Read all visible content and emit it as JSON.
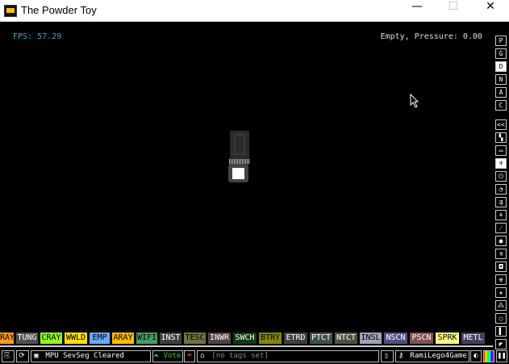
{
  "window": {
    "title": "The Powder Toy",
    "min": "—",
    "max": "☐",
    "close": "✕"
  },
  "hud": {
    "fps_label": "FPS:",
    "fps_value": "57.29",
    "status": "Empty, Pressure: 0.00"
  },
  "right_menu": [
    {
      "label": "P",
      "name": "pause-sim-button"
    },
    {
      "label": "G",
      "name": "gravity-button"
    },
    {
      "label": "D",
      "name": "decorations-button",
      "selected": true
    },
    {
      "label": "N",
      "name": "newtonian-button"
    },
    {
      "label": "A",
      "name": "ambient-heat-button"
    },
    {
      "label": "C",
      "name": "console-button"
    },
    {
      "label": "<<",
      "name": "menu-collapse-button"
    },
    {
      "label": "▚",
      "name": "walls-category-button"
    },
    {
      "label": "▭",
      "name": "electronics-category-button"
    },
    {
      "label": "♆",
      "name": "powered-category-button",
      "selected": true
    },
    {
      "label": "⏻",
      "name": "sensors-category-button"
    },
    {
      "label": "◔",
      "name": "force-category-button"
    },
    {
      "label": "⇶",
      "name": "explosives-category-button"
    },
    {
      "label": "⚘",
      "name": "gases-category-button"
    },
    {
      "label": "⁄",
      "name": "liquids-category-button"
    },
    {
      "label": "●",
      "name": "powders-category-button"
    },
    {
      "label": "⚗",
      "name": "solids-category-button"
    },
    {
      "label": "◘",
      "name": "radioactive-category-button"
    },
    {
      "label": "☢",
      "name": "special-category-button"
    },
    {
      "label": "★",
      "name": "life-category-button"
    },
    {
      "label": "⁂",
      "name": "tools-category-button"
    },
    {
      "label": "○",
      "name": "favorites-category-button"
    },
    {
      "label": "▌",
      "name": "decoration-tools-button"
    },
    {
      "label": "◤",
      "name": "search-category-button"
    },
    {
      "label": "🔍",
      "name": "search-elements-button"
    }
  ],
  "elements": [
    {
      "label": "RAY",
      "bg": "#ff9a1e",
      "fg": "#000",
      "w": 17
    },
    {
      "label": "TUNG",
      "bg": "#505050",
      "fg": "#fff",
      "w": 27
    },
    {
      "label": "CRAY",
      "bg": "#8dff1f",
      "fg": "#000",
      "w": 27
    },
    {
      "label": "WWLD",
      "bg": "#ffe000",
      "fg": "#000",
      "w": 28
    },
    {
      "label": "EMP",
      "bg": "#66aaff",
      "fg": "#000",
      "w": 25
    },
    {
      "label": "ARAY",
      "bg": "#ffbb00",
      "fg": "#000",
      "w": 27
    },
    {
      "label": "WIFI",
      "bg": "#40a060",
      "fg": "#000",
      "w": 26
    },
    {
      "label": "INST",
      "bg": "#404040",
      "fg": "#fff",
      "w": 27
    },
    {
      "label": "TESC",
      "bg": "#707040",
      "fg": "#000",
      "w": 27
    },
    {
      "label": "INWR",
      "bg": "#544141",
      "fg": "#fff",
      "w": 28
    },
    {
      "label": "SWCH",
      "bg": "#103b11",
      "fg": "#fff",
      "w": 29
    },
    {
      "label": "BTRY",
      "bg": "#858505",
      "fg": "#000",
      "w": 28
    },
    {
      "label": "ETRD",
      "bg": "#404040",
      "fg": "#fff",
      "w": 29
    },
    {
      "label": "PTCT",
      "bg": "#405050",
      "fg": "#fff",
      "w": 28
    },
    {
      "label": "NTCT",
      "bg": "#505040",
      "fg": "#fff",
      "w": 28
    },
    {
      "label": "INSL",
      "bg": "#9ea3b6",
      "fg": "#000",
      "w": 27
    },
    {
      "label": "NSCN",
      "bg": "#505080",
      "fg": "#fff",
      "w": 29
    },
    {
      "label": "PSCN",
      "bg": "#805050",
      "fg": "#fff",
      "w": 29
    },
    {
      "label": "SPRK",
      "bg": "#ffff80",
      "fg": "#000",
      "w": 29
    },
    {
      "label": "METL",
      "bg": "#404060",
      "fg": "#fff",
      "w": 29
    }
  ],
  "bottom": {
    "save_title": "MPU SevSeg Cleared",
    "vote_label": "Vote",
    "tags": "[no tags set]",
    "username": "RamiLego4Game"
  }
}
